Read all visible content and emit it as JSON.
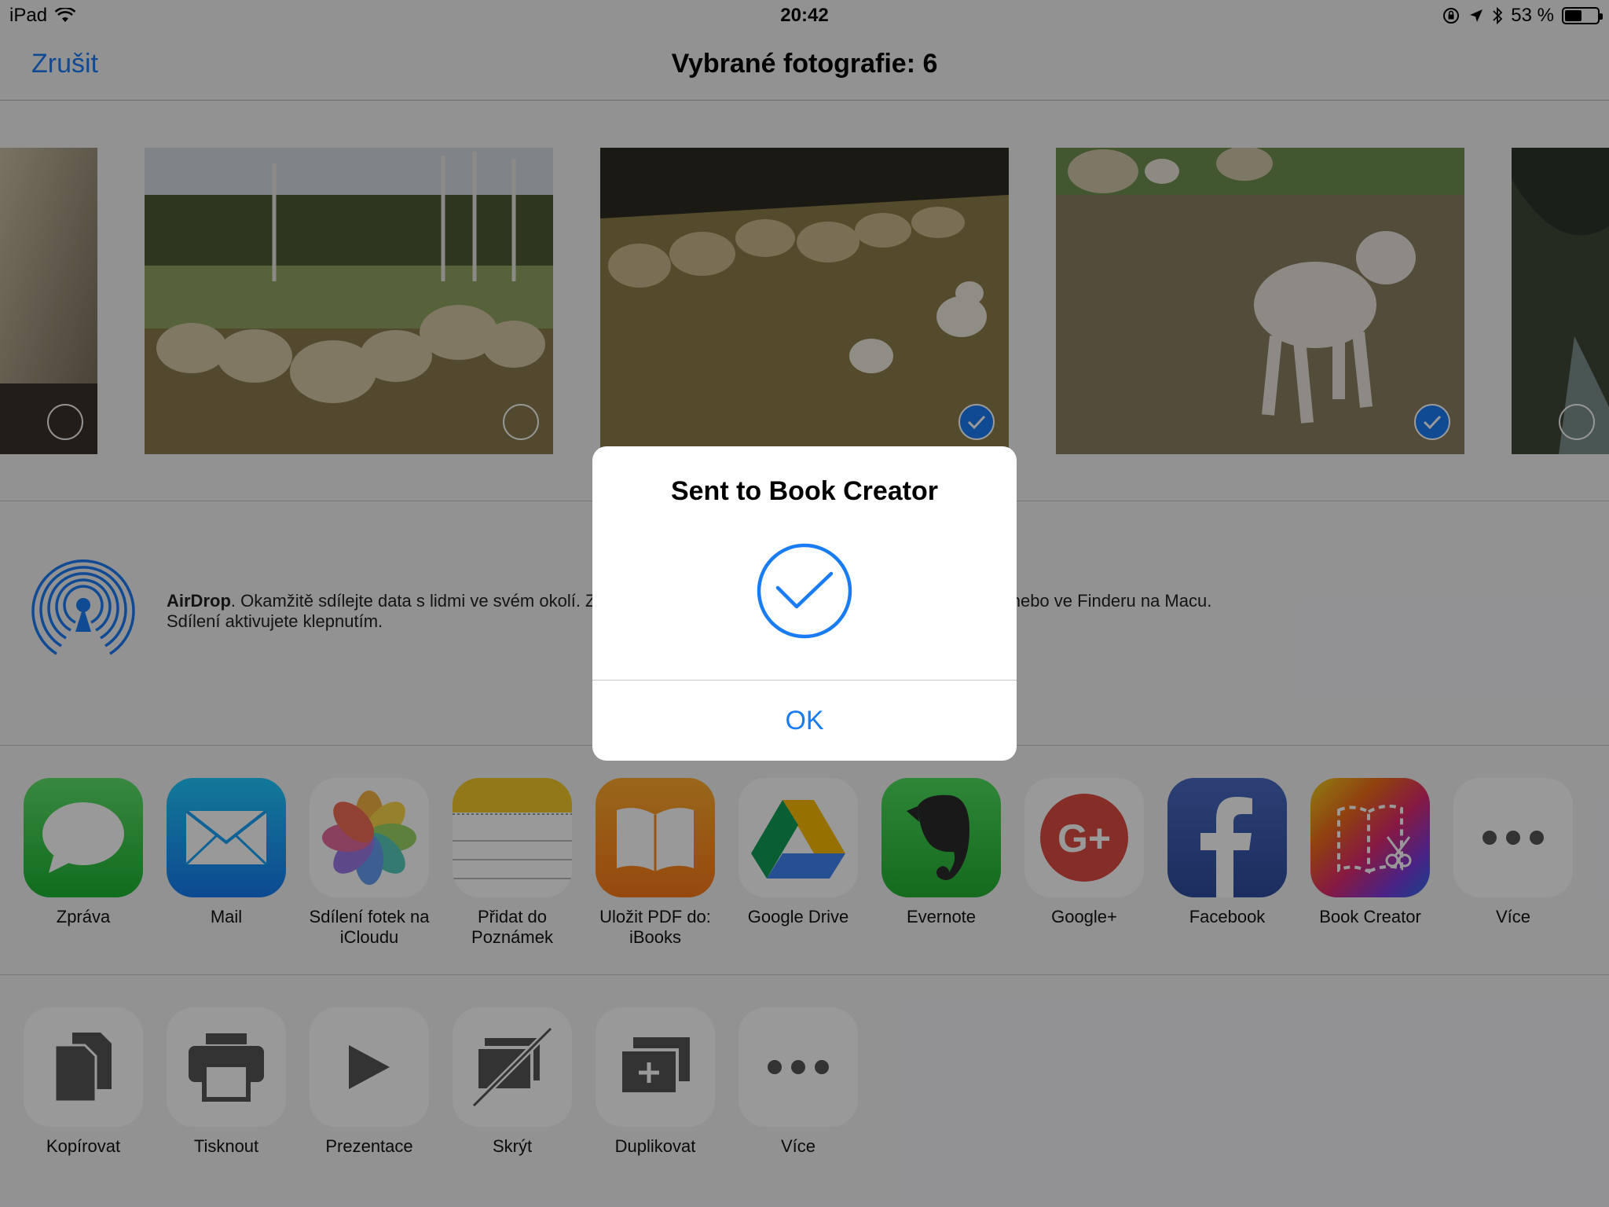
{
  "status_bar": {
    "device": "iPad",
    "time": "20:42",
    "battery_text": "53 %",
    "battery_level": 0.53
  },
  "nav": {
    "cancel": "Zrušit",
    "title": "Vybrané fotografie: 6"
  },
  "airdrop": {
    "name": "AirDrop",
    "text_line1": ". Okamžitě sdílejte data s lidmi ve svém okolí. Zapněte si AirDrop v Ovládacím centru na iOS zařízení nebo ve Finderu na Macu.",
    "text_line2": "Sdílení aktivujete klepnutím."
  },
  "share_apps": [
    {
      "label": "Zpráva",
      "icon": "messages-icon"
    },
    {
      "label": "Mail",
      "icon": "mail-icon"
    },
    {
      "label": "Sdílení fotek na iCloudu",
      "icon": "photos-icon"
    },
    {
      "label": "Přidat do Poznámek",
      "icon": "notes-icon"
    },
    {
      "label": "Uložit PDF do: iBooks",
      "icon": "ibooks-icon"
    },
    {
      "label": "Google Drive",
      "icon": "google-drive-icon"
    },
    {
      "label": "Evernote",
      "icon": "evernote-icon"
    },
    {
      "label": "Google+",
      "icon": "google-plus-icon"
    },
    {
      "label": "Facebook",
      "icon": "facebook-icon"
    },
    {
      "label": "Book Creator",
      "icon": "book-creator-icon"
    },
    {
      "label": "Více",
      "icon": "more-icon"
    }
  ],
  "actions": [
    {
      "label": "Kopírovat",
      "icon": "copy-icon"
    },
    {
      "label": "Tisknout",
      "icon": "print-icon"
    },
    {
      "label": "Prezentace",
      "icon": "play-icon"
    },
    {
      "label": "Skrýt",
      "icon": "hide-icon"
    },
    {
      "label": "Duplikovat",
      "icon": "duplicate-icon"
    },
    {
      "label": "Více",
      "icon": "more-icon"
    }
  ],
  "alert": {
    "title": "Sent to Book Creator",
    "ok": "OK"
  },
  "colors": {
    "accent": "#1a7cf5"
  }
}
